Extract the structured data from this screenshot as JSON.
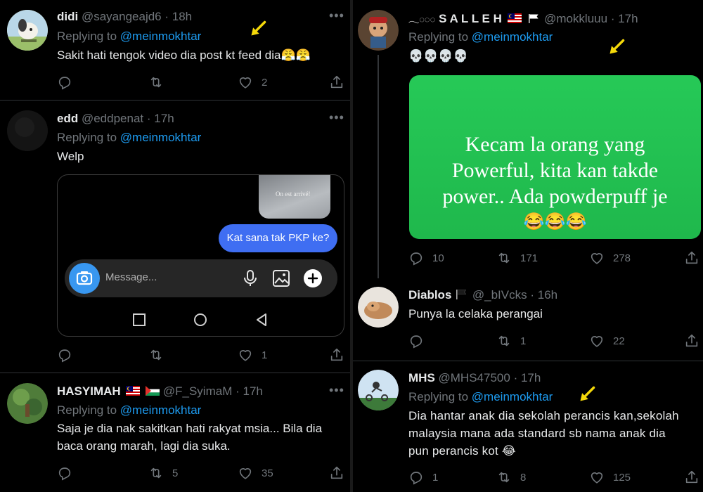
{
  "left": {
    "t1": {
      "name": "didi",
      "handle": "@sayangeajd6",
      "time": "18h",
      "reply_prefix": "Replying to",
      "mention": "@meinmokhtar",
      "text": "Sakit hati tengok video dia post kt feed dia😤😤",
      "likes": "2"
    },
    "t2": {
      "name": "edd",
      "handle": "@eddpenat",
      "time": "17h",
      "reply_prefix": "Replying to",
      "mention": "@meinmokhtar",
      "text": "Welp",
      "likes": "1",
      "embed": {
        "small_caption": "On est arrivé!",
        "bubble": "Kat sana tak PKP ke?",
        "message_placeholder": "Message..."
      }
    },
    "t3": {
      "name": "HASYIMAH",
      "handle": "@F_SyimaM",
      "time": "17h",
      "reply_prefix": "Replying to",
      "mention": "@meinmokhtar",
      "text_line1": "Saja je dia nak sakitkan hati rakyat msia... Bila dia",
      "text_line2": "baca orang marah, lagi dia suka.",
      "retweets": "5",
      "likes": "35"
    }
  },
  "right": {
    "t1": {
      "name": "S A L L E H",
      "handle": "@mokkluuu",
      "time": "17h",
      "reply_prefix": "Replying to",
      "mention": "@meinmokhtar",
      "text": "💀💀💀💀",
      "image_line1": "Kecam la orang yang",
      "image_line2": "Powerful, kita kan takde",
      "image_line3": "power.. Ada powderpuff je",
      "image_line4": "😂😂😂",
      "replies": "10",
      "retweets": "171",
      "likes": "278"
    },
    "t2": {
      "name": "Diablos",
      "handle": "@_bIVcks",
      "time": "16h",
      "text": "Punya la celaka perangai",
      "retweets": "1",
      "likes": "22"
    },
    "t3": {
      "name": "MHS",
      "handle": "@MHS47500",
      "time": "17h",
      "reply_prefix": "Replying to",
      "mention": "@meinmokhtar",
      "text_line1": "Dia hantar anak dia sekolah perancis kan,sekolah",
      "text_line2": "malaysia mana ada standard sb nama anak dia",
      "text_line3": "pun perancis kot 😂",
      "replies": "1",
      "retweets": "8",
      "likes": "125"
    }
  },
  "colors": {
    "bg": "#000000",
    "text": "#e7e9ea",
    "muted": "#71767b",
    "link": "#1d9bf0",
    "arrow": "#f5d90a",
    "green": "#22c95a"
  }
}
